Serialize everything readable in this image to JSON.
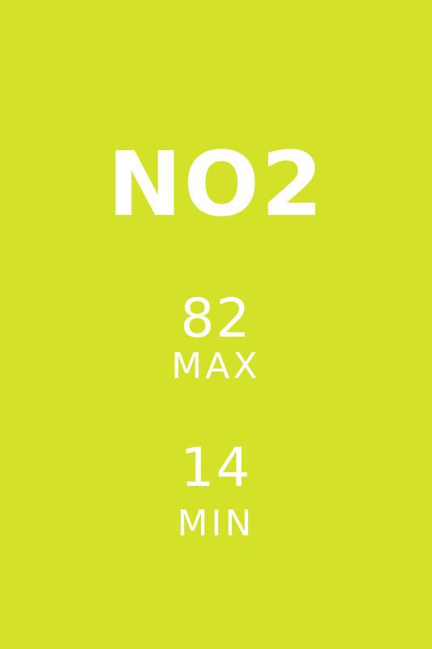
{
  "theme": {
    "background": "#d3e128",
    "text_color": "#ffffff"
  },
  "pollutant": {
    "name": "NO2"
  },
  "max": {
    "value": "82",
    "label": "MAX"
  },
  "min": {
    "value": "14",
    "label": "MIN"
  }
}
